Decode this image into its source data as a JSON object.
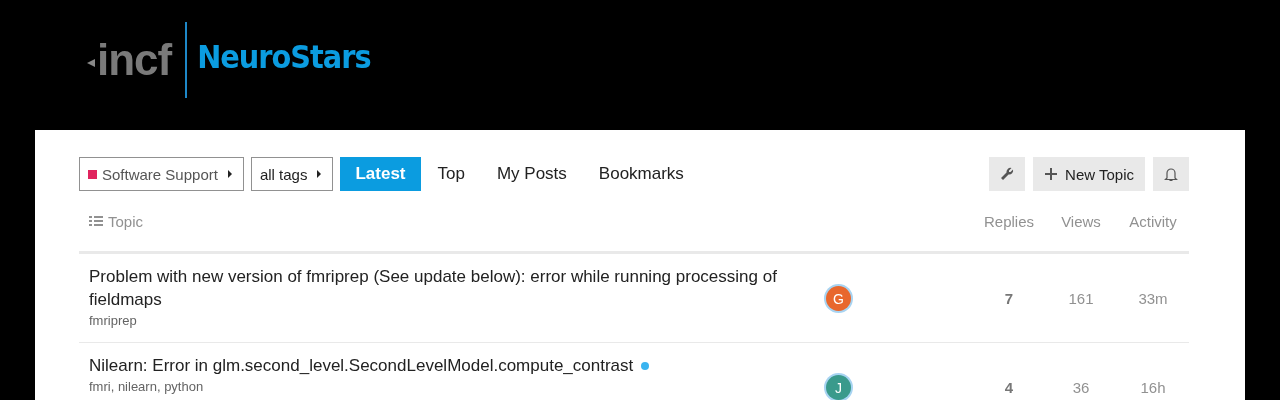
{
  "logo": {
    "org": "incf",
    "site": "NeuroStars"
  },
  "filters": [
    {
      "label": "Software Support",
      "color": "#e0245e"
    },
    {
      "label": "all tags"
    }
  ],
  "nav_tabs": [
    {
      "label": "Latest",
      "selected": true
    },
    {
      "label": "Top",
      "selected": false
    },
    {
      "label": "My Posts",
      "selected": false
    },
    {
      "label": "Bookmarks",
      "selected": false
    }
  ],
  "new_topic_button": "New Topic",
  "columns": [
    "Topic",
    "Replies",
    "Views",
    "Activity"
  ],
  "topics": [
    {
      "title": "Problem with new version of fmriprep (See update below): error while running processing of fieldmaps",
      "tags": "fmriprep",
      "unread": false,
      "avatar": "G",
      "color": "#e8672d",
      "replies": "7",
      "views": "161",
      "activity": "33m"
    },
    {
      "title": "Nilearn: Error in glm.second_level.SecondLevelModel.compute_contrast",
      "tags": "fmri, nilearn, python",
      "unread": true,
      "avatar": "J",
      "color": "#3a9a8c",
      "replies": "4",
      "views": "36",
      "activity": "16h"
    }
  ]
}
